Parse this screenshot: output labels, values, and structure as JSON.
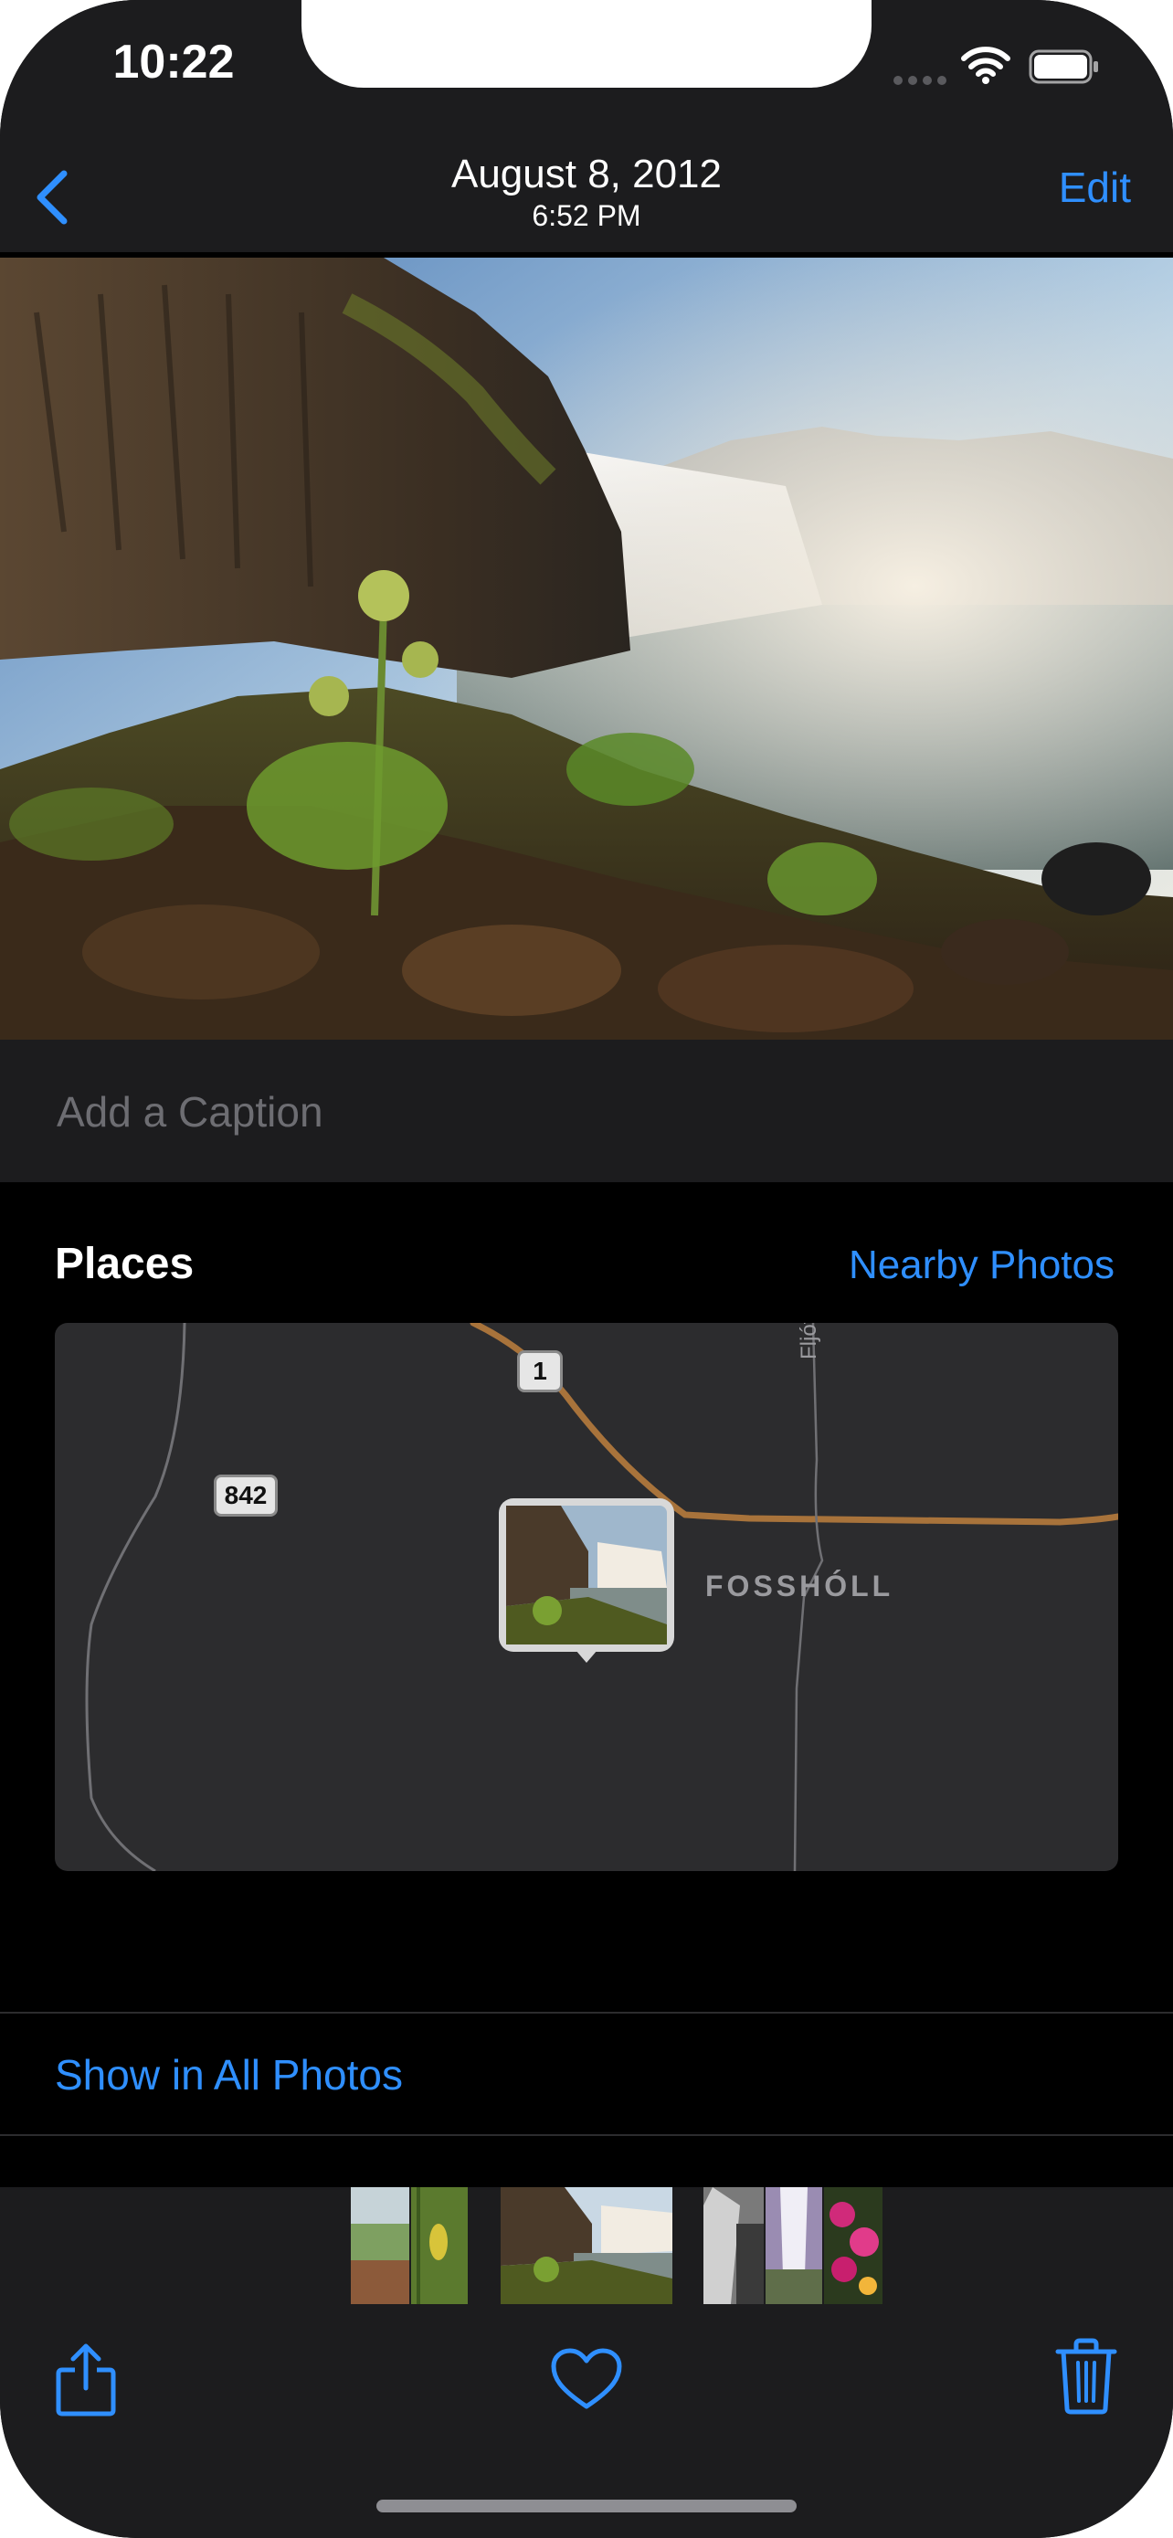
{
  "status_bar": {
    "time": "10:22"
  },
  "nav": {
    "title": "August 8, 2012",
    "subtitle": "6:52 PM",
    "edit_label": "Edit"
  },
  "caption": {
    "placeholder": "Add a Caption"
  },
  "places": {
    "title": "Places",
    "nearby_label": "Nearby Photos",
    "map": {
      "shield_842": "842",
      "shield_1": "1",
      "place_label": "FOSSHÓLL",
      "river_label": "Fljóts"
    }
  },
  "show_all_label": "Show in All Photos",
  "colors": {
    "accent": "#2f8fff",
    "background": "#000000",
    "panel": "#1c1c1e",
    "map": "#2c2c2e",
    "road_major": "#a8733b"
  },
  "icons": [
    "back-chevron-icon",
    "wifi-icon",
    "battery-icon",
    "share-icon",
    "heart-icon",
    "trash-icon"
  ]
}
